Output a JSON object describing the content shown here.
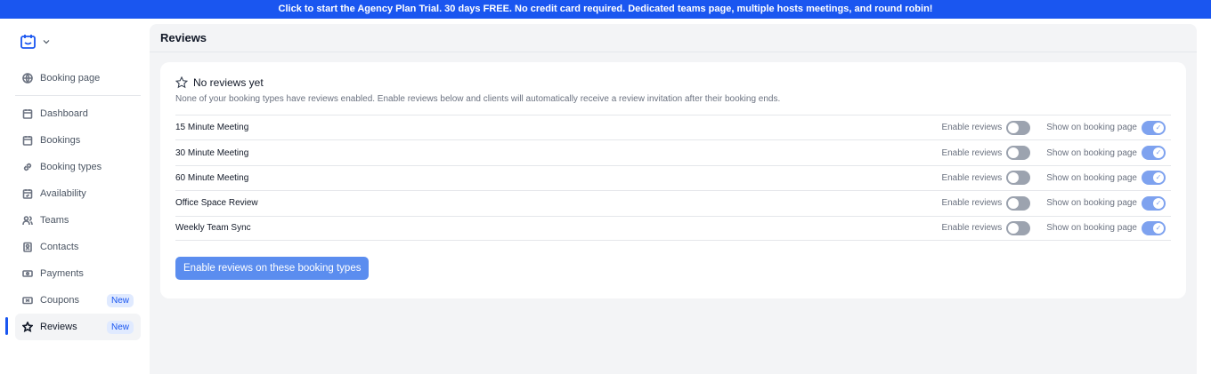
{
  "banner": "Click to start the Agency Plan Trial. 30 days FREE. No credit card required. Dedicated teams page, multiple hosts meetings, and round robin!",
  "sidebar": {
    "top": {
      "label": "Booking page",
      "icon": "globe-icon"
    },
    "items": [
      {
        "label": "Dashboard",
        "icon": "calendar-icon"
      },
      {
        "label": "Bookings",
        "icon": "calendar-icon"
      },
      {
        "label": "Booking types",
        "icon": "link-icon"
      },
      {
        "label": "Availability",
        "icon": "calendar-check-icon"
      },
      {
        "label": "Teams",
        "icon": "users-icon"
      },
      {
        "label": "Contacts",
        "icon": "contact-icon"
      },
      {
        "label": "Payments",
        "icon": "cash-icon"
      },
      {
        "label": "Coupons",
        "icon": "ticket-icon",
        "badge": "New"
      },
      {
        "label": "Reviews",
        "icon": "star-icon",
        "badge": "New",
        "active": true
      }
    ]
  },
  "page": {
    "title": "Reviews",
    "empty_title": "No reviews yet",
    "empty_desc": "None of your booking types have reviews enabled. Enable reviews below and clients will automatically receive a review invitation after their booking ends.",
    "enable_label": "Enable reviews",
    "show_label": "Show on booking page",
    "rows": [
      {
        "name": "15 Minute Meeting",
        "enabled": false,
        "show": true
      },
      {
        "name": "30 Minute Meeting",
        "enabled": false,
        "show": true
      },
      {
        "name": "60 Minute Meeting",
        "enabled": false,
        "show": true
      },
      {
        "name": "Office Space Review",
        "enabled": false,
        "show": true
      },
      {
        "name": "Weekly Team Sync",
        "enabled": false,
        "show": true
      }
    ],
    "button": "Enable reviews on these booking types"
  }
}
